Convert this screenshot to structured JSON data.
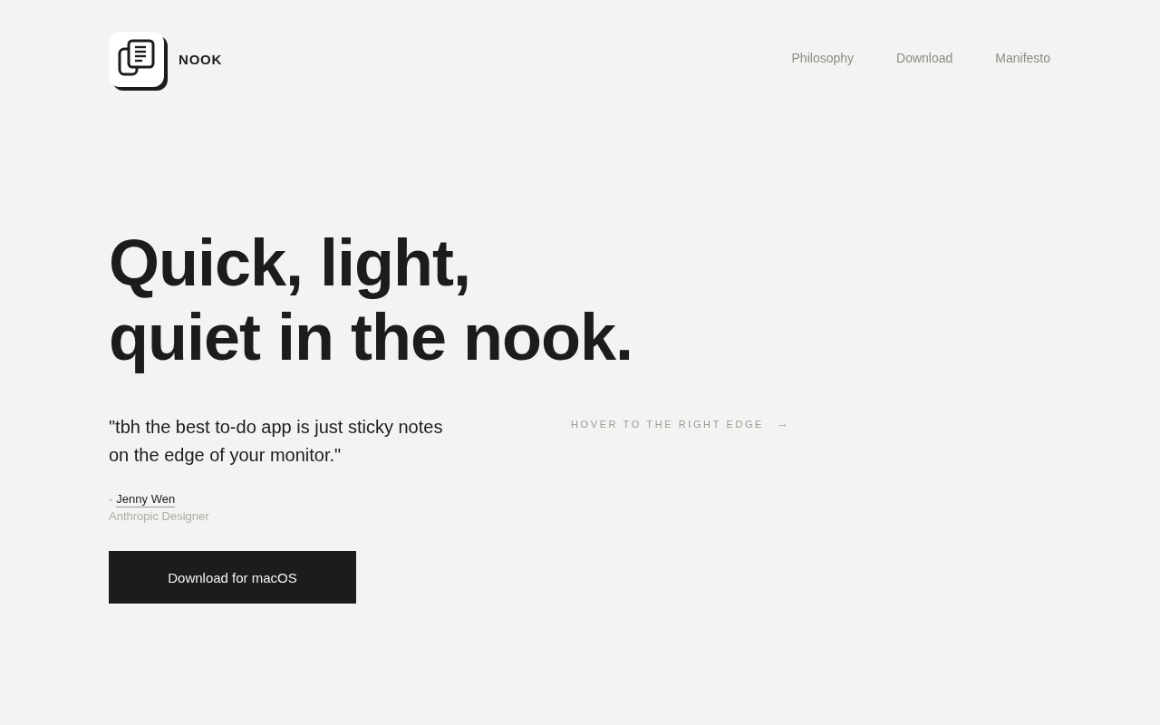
{
  "brand": {
    "name": "NOOK"
  },
  "nav": {
    "links": [
      "Philosophy",
      "Download",
      "Manifesto"
    ]
  },
  "hero": {
    "headline": [
      "Quick, light,",
      "quiet in the nook."
    ],
    "quote": "\"tbh the best to-do app is just sticky notes on the edge of your monitor.\"",
    "attribution": {
      "prefix": "-",
      "name": "Jenny Wen",
      "role": "Anthropic Designer"
    },
    "hint": "HOVER TO THE RIGHT EDGE",
    "cta": "Download for macOS"
  }
}
